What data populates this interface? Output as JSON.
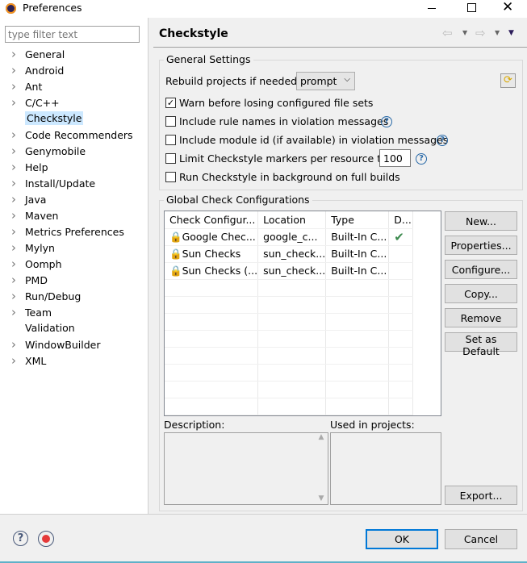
{
  "window": {
    "title": "Preferences",
    "minimize_icon": "minimize-icon",
    "maximize_icon": "maximize-icon",
    "close_icon": "close-icon"
  },
  "sidebar": {
    "filter_placeholder": "type filter text",
    "items": [
      {
        "label": "General",
        "expandable": true
      },
      {
        "label": "Android",
        "expandable": true
      },
      {
        "label": "Ant",
        "expandable": true
      },
      {
        "label": "C/C++",
        "expandable": true
      },
      {
        "label": "Checkstyle",
        "expandable": false,
        "selected": true
      },
      {
        "label": "Code Recommenders",
        "expandable": true
      },
      {
        "label": "Genymobile",
        "expandable": true
      },
      {
        "label": "Help",
        "expandable": true
      },
      {
        "label": "Install/Update",
        "expandable": true
      },
      {
        "label": "Java",
        "expandable": true
      },
      {
        "label": "Maven",
        "expandable": true
      },
      {
        "label": "Metrics Preferences",
        "expandable": true
      },
      {
        "label": "Mylyn",
        "expandable": true
      },
      {
        "label": "Oomph",
        "expandable": true
      },
      {
        "label": "PMD",
        "expandable": true
      },
      {
        "label": "Run/Debug",
        "expandable": true
      },
      {
        "label": "Team",
        "expandable": true
      },
      {
        "label": "Validation",
        "expandable": false
      },
      {
        "label": "WindowBuilder",
        "expandable": true
      },
      {
        "label": "XML",
        "expandable": true
      }
    ]
  },
  "page": {
    "title": "Checkstyle",
    "general": {
      "title": "General Settings",
      "rebuild_label": "Rebuild projects if needed:",
      "rebuild_value": "prompt",
      "options": [
        {
          "label": "Warn before losing configured file sets",
          "checked": true,
          "help": false
        },
        {
          "label": "Include rule names in violation messages",
          "checked": false,
          "help": true
        },
        {
          "label": "Include module id (if available) in violation messages",
          "checked": false,
          "help": true
        },
        {
          "label": "Limit Checkstyle markers per resource to",
          "checked": false,
          "help": true
        },
        {
          "label": "Run Checkstyle in background on full builds",
          "checked": false,
          "help": false
        }
      ],
      "limit_value": "100"
    },
    "global": {
      "title": "Global Check Configurations",
      "columns": [
        "Check Configur...",
        "Location",
        "Type",
        "D..."
      ],
      "rows": [
        {
          "name": "Google Chec...",
          "location": "google_c...",
          "type": "Built-In C...",
          "default": true
        },
        {
          "name": "Sun Checks",
          "location": "sun_check...",
          "type": "Built-In C...",
          "default": false
        },
        {
          "name": "Sun Checks (...",
          "location": "sun_check...",
          "type": "Built-In C...",
          "default": false
        }
      ],
      "buttons": [
        "New...",
        "Properties...",
        "Configure...",
        "Copy...",
        "Remove",
        "Set as Default"
      ],
      "description_label": "Description:",
      "used_label": "Used in projects:",
      "export": "Export..."
    }
  },
  "footer": {
    "ok": "OK",
    "cancel": "Cancel"
  },
  "colors": {
    "selection": "#cce8ff",
    "check": "#3c8a4e",
    "ok_border": "#0078d7"
  }
}
